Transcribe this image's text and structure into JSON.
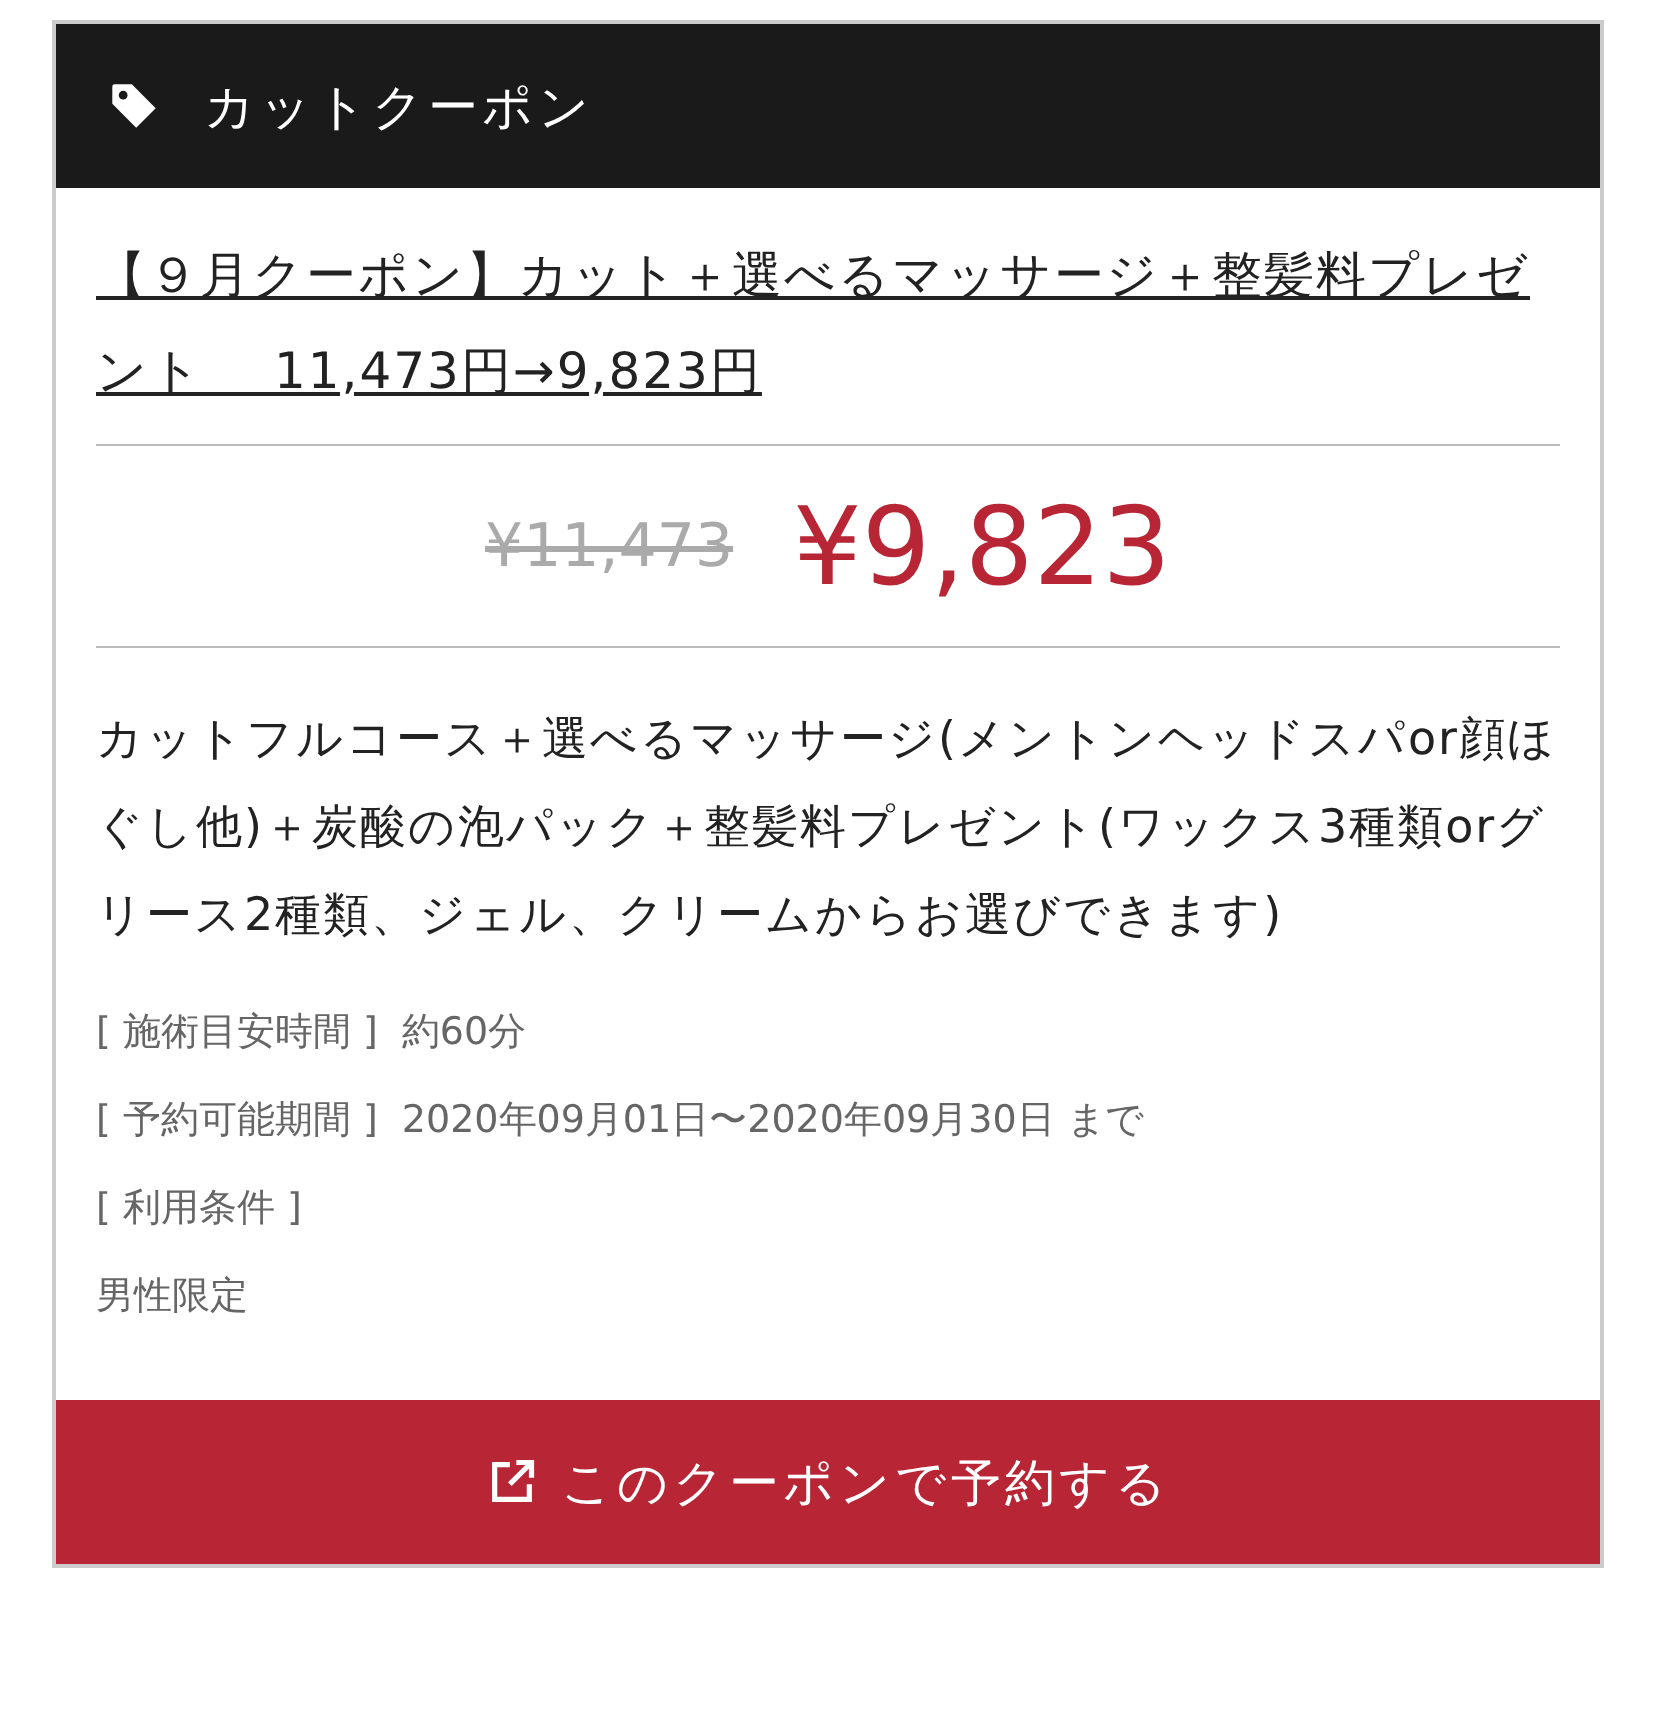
{
  "header": {
    "title": "カットクーポン"
  },
  "coupon": {
    "title": "【９月クーポン】カット＋選べるマッサージ＋整髪料プレゼント　 11,473円→9,823円",
    "old_price": "¥11,473",
    "price": "¥9,823",
    "description": "カットフルコース＋選べるマッサージ(メントンヘッドスパor顔ほぐし他)＋炭酸の泡パック＋整髪料プレゼント(ワックス3種類orグリース2種類、ジェル、クリームからお選びできます)",
    "details": [
      {
        "label": "[ 施術目安時間 ]",
        "value": "約60分"
      },
      {
        "label": "[ 予約可能期間 ]",
        "value": "2020年09月01日〜2020年09月30日 まで"
      },
      {
        "label": "[ 利用条件 ]"
      },
      {
        "value": "男性限定"
      }
    ]
  },
  "button": {
    "label": "このクーポンで予約する"
  }
}
